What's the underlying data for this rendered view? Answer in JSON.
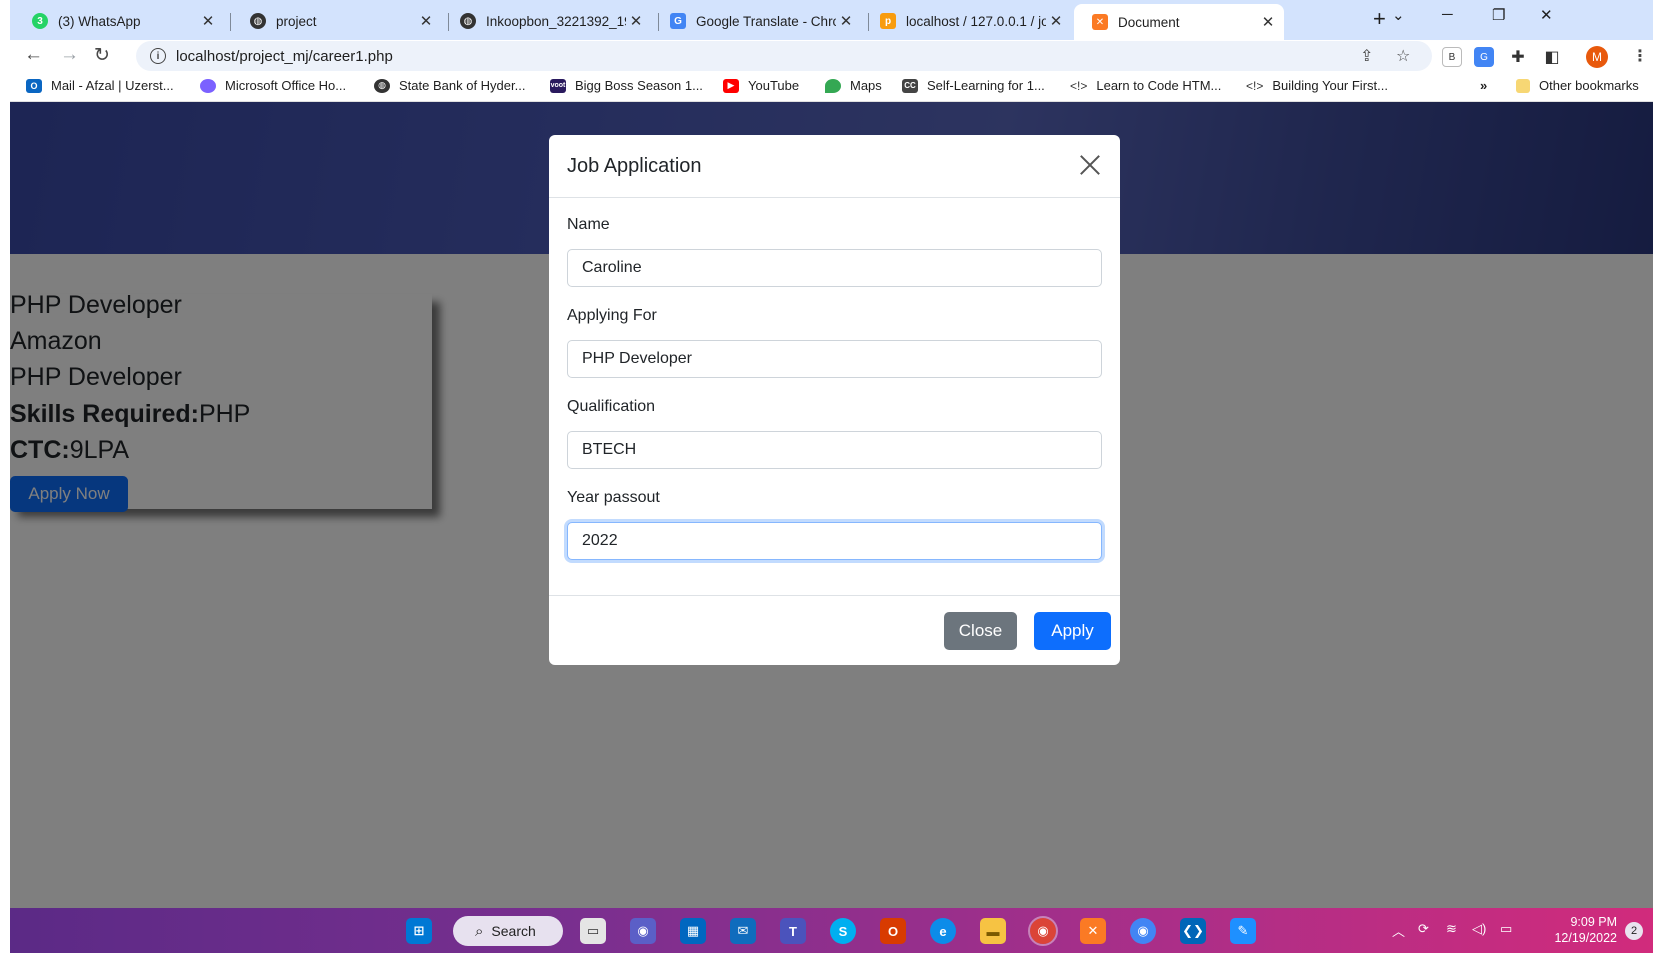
{
  "browser": {
    "tabs": [
      {
        "title": "(3) WhatsApp",
        "favicon": "whatsapp-icon",
        "color": "#25d366",
        "badge": "3"
      },
      {
        "title": "project",
        "favicon": "globe-icon",
        "color": "#333333"
      },
      {
        "title": "Inkoopbon_3221392_19",
        "favicon": "globe-icon",
        "color": "#333333"
      },
      {
        "title": "Google Translate - Chror",
        "favicon": "translate-icon",
        "color": "#4285f4"
      },
      {
        "title": "localhost / 127.0.0.1 / jo",
        "favicon": "phpmyadmin-icon",
        "color": "#f89c0e"
      },
      {
        "title": "Document",
        "favicon": "xampp-icon",
        "color": "#fb7a24",
        "active": true
      }
    ],
    "url": "localhost/project_mj/career1.php",
    "profile_initial": "M",
    "extension_b": "B",
    "bookmarks": [
      {
        "label": "Mail - Afzal | Uzerst...",
        "icon": "outlook-icon",
        "color": "#0a66c2"
      },
      {
        "label": "Microsoft Office Ho...",
        "icon": "office-icon",
        "color": "#7b61ff"
      },
      {
        "label": "State Bank of Hyder...",
        "icon": "globe-icon",
        "color": "#333333"
      },
      {
        "label": "Bigg Boss Season 1...",
        "icon": "voot-icon",
        "color": "#2a1a5e",
        "mark": "voot"
      },
      {
        "label": "YouTube",
        "icon": "youtube-icon",
        "color": "#ff0000"
      },
      {
        "label": "Maps",
        "icon": "maps-icon",
        "color": "#34a853"
      },
      {
        "label": "Self-Learning for 1...",
        "icon": "cc-icon",
        "color": "#444444",
        "mark": "CC"
      },
      {
        "label": "Learn to Code HTM...",
        "icon": "code-icon",
        "color": "#555555",
        "mark": "<!>"
      },
      {
        "label": "Building Your First...",
        "icon": "code-icon",
        "color": "#555555",
        "mark": "<!>"
      }
    ],
    "bookmarks_overflow": "»",
    "other_bookmarks": "Other bookmarks"
  },
  "page": {
    "job": {
      "title": "PHP Developer",
      "company": "Amazon",
      "role": "PHP Developer",
      "skills_label": "Skills Required:",
      "skills_value": "PHP",
      "ctc_label": "CTC:",
      "ctc_value": "9LPA",
      "apply_button": "Apply Now"
    }
  },
  "modal": {
    "title": "Job Application",
    "fields": {
      "name_label": "Name",
      "name_value": "Caroline",
      "applying_label": "Applying For",
      "applying_value": "PHP Developer",
      "qualification_label": "Qualification",
      "qualification_value": "BTECH",
      "year_label": "Year passout",
      "year_value": "2022"
    },
    "close_button": "Close",
    "apply_button": "Apply"
  },
  "taskbar": {
    "search_label": "Search",
    "time": "9:09 PM",
    "date": "12/19/2022",
    "notification_count": "2"
  }
}
